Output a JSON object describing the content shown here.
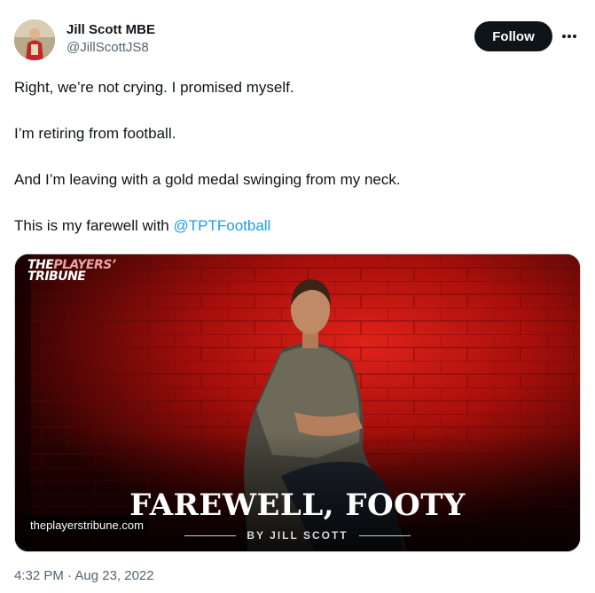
{
  "author": {
    "display_name": "Jill Scott MBE",
    "handle": "@JillScottJS8"
  },
  "actions": {
    "follow_label": "Follow",
    "more_icon": "more-horizontal-icon"
  },
  "tweet": {
    "paragraphs": [
      "Right, we’re not crying. I promised myself.",
      "I’m retiring from football.",
      "And I’m leaving with a gold medal swinging from my neck."
    ],
    "last_line_prefix": "This is my farewell with ",
    "mention": "@TPTFootball",
    "timestamp": "4:32 PM · Aug 23, 2022"
  },
  "media": {
    "brand_part1": "THE",
    "brand_part2": "PLAYERS’",
    "brand_part3": "TRIBUNE",
    "headline": "FAREWELL, FOOTY",
    "byline": "BY JILL SCOTT",
    "url": "theplayerstribune.com"
  },
  "colors": {
    "accent": "#1d9bf0",
    "follow_bg": "#0f1419",
    "secondary_text": "#536471",
    "backdrop_red": "#c0110e"
  }
}
